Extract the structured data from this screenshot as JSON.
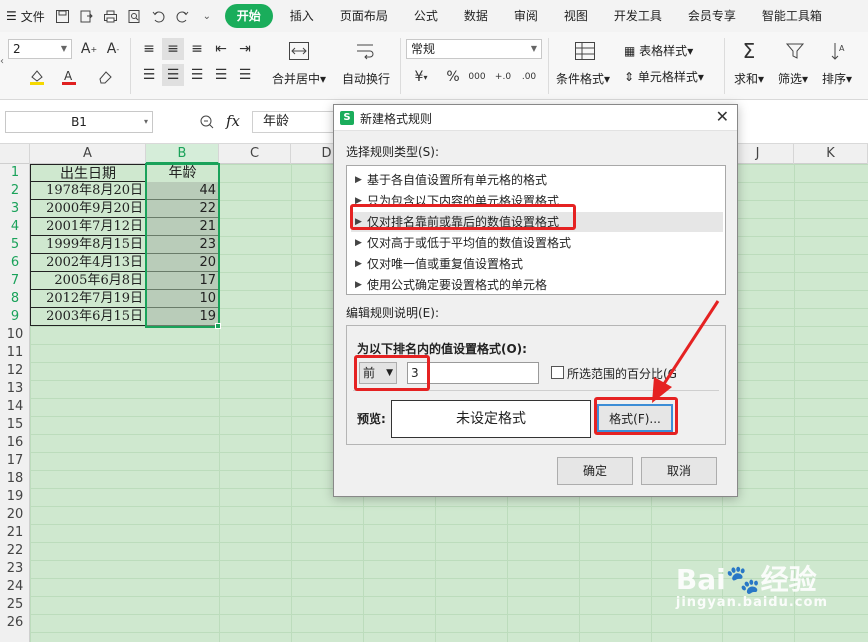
{
  "menubar": {
    "file_label": "文件",
    "tabs": [
      "开始",
      "插入",
      "页面布局",
      "公式",
      "数据",
      "审阅",
      "视图",
      "开发工具",
      "会员专享",
      "智能工具箱"
    ],
    "active_tab": "开始"
  },
  "ribbon": {
    "font_size": "2",
    "number_format": "常规",
    "merge_label": "合并居中",
    "wrap_label": "自动换行",
    "currency_symbol": "¥",
    "percent_symbol": "%",
    "thousands_symbol": "000",
    "cond_format_label": "条件格式",
    "table_style_label": "表格样式",
    "cell_style_label": "单元格样式",
    "sum_label": "求和",
    "filter_label": "筛选",
    "sort_label": "排序",
    "sum_symbol": "Σ"
  },
  "formula_bar": {
    "cell_ref": "B1",
    "fx_label": "fx",
    "content": "年龄"
  },
  "grid": {
    "columns": [
      "A",
      "B",
      "C",
      "D",
      "J",
      "K"
    ],
    "rows": [
      "1",
      "2",
      "3",
      "4",
      "5",
      "6",
      "7",
      "8",
      "9",
      "10",
      "11",
      "12",
      "13",
      "14",
      "15",
      "16",
      "17",
      "18",
      "19",
      "20",
      "21",
      "22",
      "23",
      "24",
      "25",
      "26"
    ],
    "header_a": "出生日期",
    "header_b": "年龄",
    "data": [
      {
        "date": "1978年8月20日",
        "age": "44"
      },
      {
        "date": "2000年9月20日",
        "age": "22"
      },
      {
        "date": "2001年7月12日",
        "age": "21"
      },
      {
        "date": "1999年8月15日",
        "age": "23"
      },
      {
        "date": "2002年4月13日",
        "age": "20"
      },
      {
        "date": "2005年6月8日",
        "age": "17"
      },
      {
        "date": "2012年7月19日",
        "age": "10"
      },
      {
        "date": "2003年6月15日",
        "age": "19"
      }
    ]
  },
  "dialog": {
    "title": "新建格式规则",
    "rule_type_label": "选择规则类型(S):",
    "rules": [
      "基于各自值设置所有单元格的格式",
      "只为包含以下内容的单元格设置格式",
      "仅对排名靠前或靠后的数值设置格式",
      "仅对高于或低于平均值的数值设置格式",
      "仅对唯一值或重复值设置格式",
      "使用公式确定要设置格式的单元格"
    ],
    "selected_rule_index": 2,
    "edit_label": "编辑规则说明(E):",
    "rank_label": "为以下排名内的值设置格式(O):",
    "rank_direction": "前",
    "rank_value": "3",
    "percent_checkbox_label": "所选范围的百分比(G)",
    "preview_label": "预览:",
    "preview_text": "未设定格式",
    "format_button": "格式(F)...",
    "ok_button": "确定",
    "cancel_button": "取消"
  },
  "watermark": {
    "brand": "Bai",
    "brand_cn": "经验",
    "url": "jingyan.baidu.com"
  },
  "colors": {
    "accent": "#1aad5b",
    "highlight": "#e52222",
    "sheet_bg": "#cfe8cf"
  }
}
